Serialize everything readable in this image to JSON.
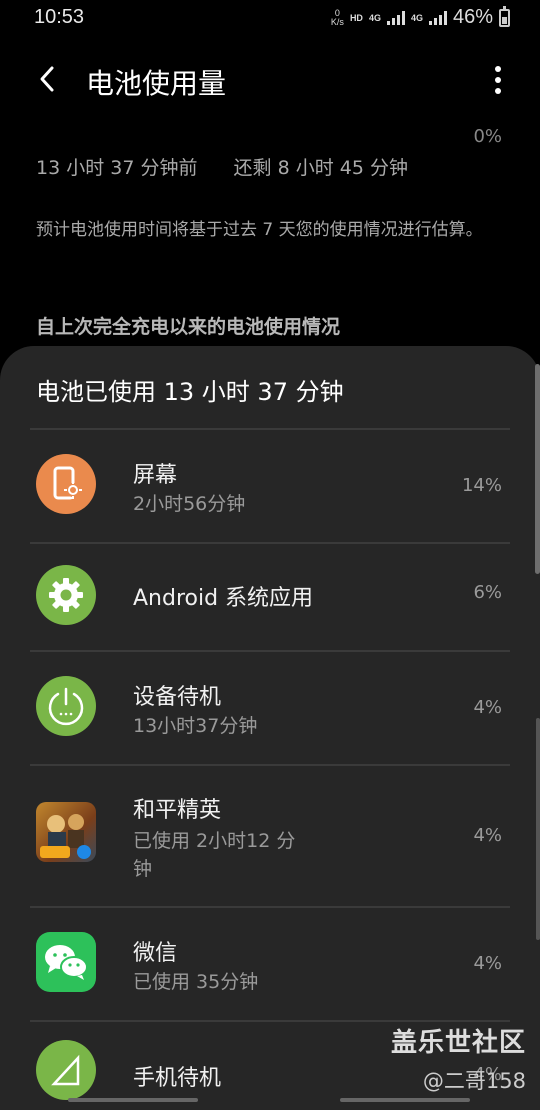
{
  "status_bar": {
    "time": "10:53",
    "net_speed_value": "0",
    "net_speed_unit": "K/s",
    "hd_label": "HD",
    "sim1_label": "4G",
    "sim2_label": "4G",
    "battery_percent": "46%",
    "battery_level": 0.46
  },
  "app_bar": {
    "title": "电池使用量"
  },
  "background": {
    "partial_percent": "0%",
    "since_time": "13 小时 37 分钟前",
    "remaining": "还剩 8 小时 45 分钟",
    "note": "预计电池使用时间将基于过去 7 天您的使用情况进行估算。",
    "section_header": "自上次完全充电以来的电池使用情况"
  },
  "sheet": {
    "title": "电池已使用 13 小时 37 分钟",
    "items": [
      {
        "name": "屏幕",
        "sub": "2小时56分钟",
        "percent": "14%",
        "icon": "screen-brightness-icon",
        "color": "#ea8a4d"
      },
      {
        "name": "Android 系统应用",
        "sub": "",
        "percent": "6%",
        "icon": "gear-icon",
        "color": "#7ab648"
      },
      {
        "name": "设备待机",
        "sub": "13小时37分钟",
        "percent": "4%",
        "icon": "power-icon",
        "color": "#7ab648"
      },
      {
        "name": "和平精英",
        "sub": "已使用 2小时12 分钟",
        "percent": "4%",
        "icon": "game-icon",
        "color": "#c2872e"
      },
      {
        "name": "微信",
        "sub": "已使用 35分钟",
        "percent": "4%",
        "icon": "wechat-icon",
        "color": "#2dc15a"
      },
      {
        "name": "手机待机",
        "sub": "",
        "percent": "4%",
        "icon": "signal-icon",
        "color": "#7ab648"
      }
    ]
  },
  "watermark": {
    "title": "盖乐世社区",
    "user": "@二哥158"
  }
}
